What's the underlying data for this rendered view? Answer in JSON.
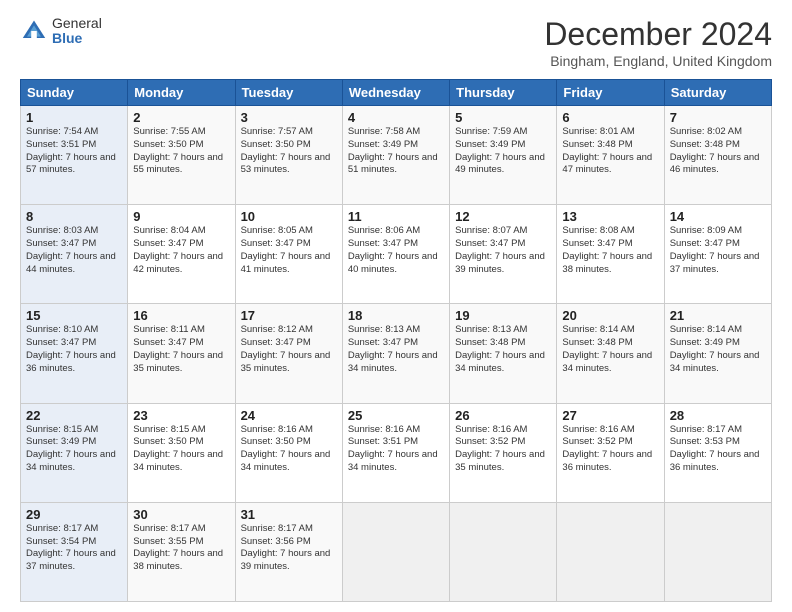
{
  "header": {
    "logo_general": "General",
    "logo_blue": "Blue",
    "title": "December 2024",
    "subtitle": "Bingham, England, United Kingdom"
  },
  "days_of_week": [
    "Sunday",
    "Monday",
    "Tuesday",
    "Wednesday",
    "Thursday",
    "Friday",
    "Saturday"
  ],
  "weeks": [
    [
      {
        "day": "1",
        "sunrise": "Sunrise: 7:54 AM",
        "sunset": "Sunset: 3:51 PM",
        "daylight": "Daylight: 7 hours and 57 minutes."
      },
      {
        "day": "2",
        "sunrise": "Sunrise: 7:55 AM",
        "sunset": "Sunset: 3:50 PM",
        "daylight": "Daylight: 7 hours and 55 minutes."
      },
      {
        "day": "3",
        "sunrise": "Sunrise: 7:57 AM",
        "sunset": "Sunset: 3:50 PM",
        "daylight": "Daylight: 7 hours and 53 minutes."
      },
      {
        "day": "4",
        "sunrise": "Sunrise: 7:58 AM",
        "sunset": "Sunset: 3:49 PM",
        "daylight": "Daylight: 7 hours and 51 minutes."
      },
      {
        "day": "5",
        "sunrise": "Sunrise: 7:59 AM",
        "sunset": "Sunset: 3:49 PM",
        "daylight": "Daylight: 7 hours and 49 minutes."
      },
      {
        "day": "6",
        "sunrise": "Sunrise: 8:01 AM",
        "sunset": "Sunset: 3:48 PM",
        "daylight": "Daylight: 7 hours and 47 minutes."
      },
      {
        "day": "7",
        "sunrise": "Sunrise: 8:02 AM",
        "sunset": "Sunset: 3:48 PM",
        "daylight": "Daylight: 7 hours and 46 minutes."
      }
    ],
    [
      {
        "day": "8",
        "sunrise": "Sunrise: 8:03 AM",
        "sunset": "Sunset: 3:47 PM",
        "daylight": "Daylight: 7 hours and 44 minutes."
      },
      {
        "day": "9",
        "sunrise": "Sunrise: 8:04 AM",
        "sunset": "Sunset: 3:47 PM",
        "daylight": "Daylight: 7 hours and 42 minutes."
      },
      {
        "day": "10",
        "sunrise": "Sunrise: 8:05 AM",
        "sunset": "Sunset: 3:47 PM",
        "daylight": "Daylight: 7 hours and 41 minutes."
      },
      {
        "day": "11",
        "sunrise": "Sunrise: 8:06 AM",
        "sunset": "Sunset: 3:47 PM",
        "daylight": "Daylight: 7 hours and 40 minutes."
      },
      {
        "day": "12",
        "sunrise": "Sunrise: 8:07 AM",
        "sunset": "Sunset: 3:47 PM",
        "daylight": "Daylight: 7 hours and 39 minutes."
      },
      {
        "day": "13",
        "sunrise": "Sunrise: 8:08 AM",
        "sunset": "Sunset: 3:47 PM",
        "daylight": "Daylight: 7 hours and 38 minutes."
      },
      {
        "day": "14",
        "sunrise": "Sunrise: 8:09 AM",
        "sunset": "Sunset: 3:47 PM",
        "daylight": "Daylight: 7 hours and 37 minutes."
      }
    ],
    [
      {
        "day": "15",
        "sunrise": "Sunrise: 8:10 AM",
        "sunset": "Sunset: 3:47 PM",
        "daylight": "Daylight: 7 hours and 36 minutes."
      },
      {
        "day": "16",
        "sunrise": "Sunrise: 8:11 AM",
        "sunset": "Sunset: 3:47 PM",
        "daylight": "Daylight: 7 hours and 35 minutes."
      },
      {
        "day": "17",
        "sunrise": "Sunrise: 8:12 AM",
        "sunset": "Sunset: 3:47 PM",
        "daylight": "Daylight: 7 hours and 35 minutes."
      },
      {
        "day": "18",
        "sunrise": "Sunrise: 8:13 AM",
        "sunset": "Sunset: 3:47 PM",
        "daylight": "Daylight: 7 hours and 34 minutes."
      },
      {
        "day": "19",
        "sunrise": "Sunrise: 8:13 AM",
        "sunset": "Sunset: 3:48 PM",
        "daylight": "Daylight: 7 hours and 34 minutes."
      },
      {
        "day": "20",
        "sunrise": "Sunrise: 8:14 AM",
        "sunset": "Sunset: 3:48 PM",
        "daylight": "Daylight: 7 hours and 34 minutes."
      },
      {
        "day": "21",
        "sunrise": "Sunrise: 8:14 AM",
        "sunset": "Sunset: 3:49 PM",
        "daylight": "Daylight: 7 hours and 34 minutes."
      }
    ],
    [
      {
        "day": "22",
        "sunrise": "Sunrise: 8:15 AM",
        "sunset": "Sunset: 3:49 PM",
        "daylight": "Daylight: 7 hours and 34 minutes."
      },
      {
        "day": "23",
        "sunrise": "Sunrise: 8:15 AM",
        "sunset": "Sunset: 3:50 PM",
        "daylight": "Daylight: 7 hours and 34 minutes."
      },
      {
        "day": "24",
        "sunrise": "Sunrise: 8:16 AM",
        "sunset": "Sunset: 3:50 PM",
        "daylight": "Daylight: 7 hours and 34 minutes."
      },
      {
        "day": "25",
        "sunrise": "Sunrise: 8:16 AM",
        "sunset": "Sunset: 3:51 PM",
        "daylight": "Daylight: 7 hours and 34 minutes."
      },
      {
        "day": "26",
        "sunrise": "Sunrise: 8:16 AM",
        "sunset": "Sunset: 3:52 PM",
        "daylight": "Daylight: 7 hours and 35 minutes."
      },
      {
        "day": "27",
        "sunrise": "Sunrise: 8:16 AM",
        "sunset": "Sunset: 3:52 PM",
        "daylight": "Daylight: 7 hours and 36 minutes."
      },
      {
        "day": "28",
        "sunrise": "Sunrise: 8:17 AM",
        "sunset": "Sunset: 3:53 PM",
        "daylight": "Daylight: 7 hours and 36 minutes."
      }
    ],
    [
      {
        "day": "29",
        "sunrise": "Sunrise: 8:17 AM",
        "sunset": "Sunset: 3:54 PM",
        "daylight": "Daylight: 7 hours and 37 minutes."
      },
      {
        "day": "30",
        "sunrise": "Sunrise: 8:17 AM",
        "sunset": "Sunset: 3:55 PM",
        "daylight": "Daylight: 7 hours and 38 minutes."
      },
      {
        "day": "31",
        "sunrise": "Sunrise: 8:17 AM",
        "sunset": "Sunset: 3:56 PM",
        "daylight": "Daylight: 7 hours and 39 minutes."
      },
      null,
      null,
      null,
      null
    ]
  ]
}
